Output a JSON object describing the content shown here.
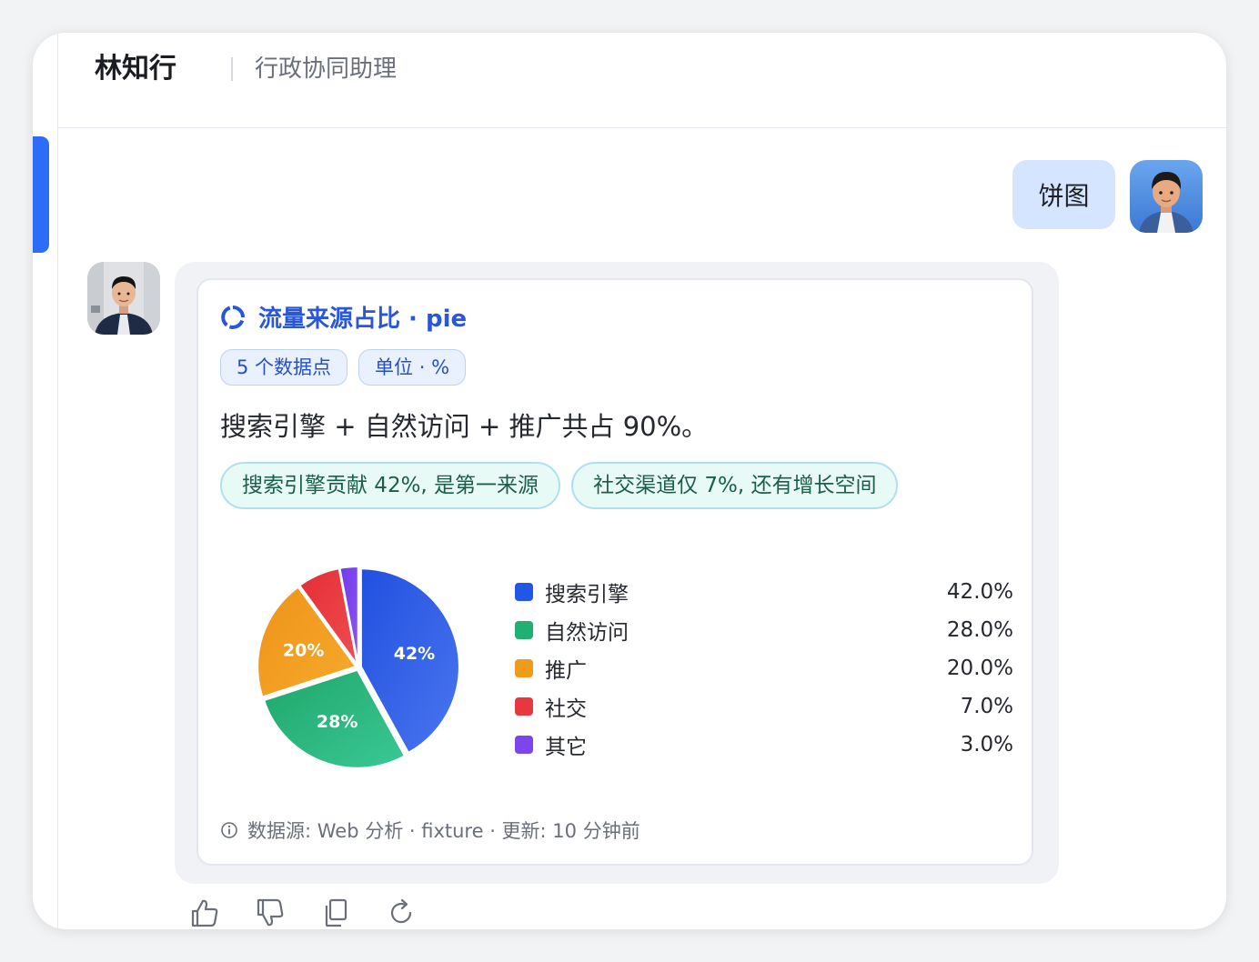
{
  "header": {
    "name": "林知行",
    "role": "行政协同助理"
  },
  "conversation": {
    "user_message": "饼图",
    "card": {
      "title": "流量来源占比 · pie",
      "chips": [
        "5 个数据点",
        "单位 · %"
      ],
      "summary": "搜索引擎 + 自然访问 + 推广共占 90%。",
      "insights": [
        "搜索引擎贡献 42%, 是第一来源",
        "社交渠道仅 7%, 还有增长空间"
      ],
      "footer": "数据源: Web 分析 · fixture · 更新: 10 分钟前"
    }
  },
  "icons": {
    "title": "ring-chart-icon",
    "footer": "info-icon",
    "actions": [
      "thumbs-up-icon",
      "thumbs-down-icon",
      "copy-icon",
      "refresh-icon"
    ]
  },
  "colors": {
    "accent": "#2c6cf6",
    "title": "#2a57d9"
  },
  "chart_data": {
    "type": "pie",
    "categories": [
      "搜索引擎",
      "自然访问",
      "推广",
      "社交",
      "其它"
    ],
    "values": [
      42,
      28,
      20,
      7,
      3
    ],
    "slice_labels": [
      "42%",
      "28%",
      "20%",
      "",
      ""
    ],
    "legend_values": [
      "42.0%",
      "28.0%",
      "20.0%",
      "7.0%",
      "3.0%"
    ],
    "colors": [
      "#2456e6",
      "#22b072",
      "#f29a1c",
      "#e8383f",
      "#7d45ec"
    ],
    "unit": "%",
    "legend": "right"
  }
}
